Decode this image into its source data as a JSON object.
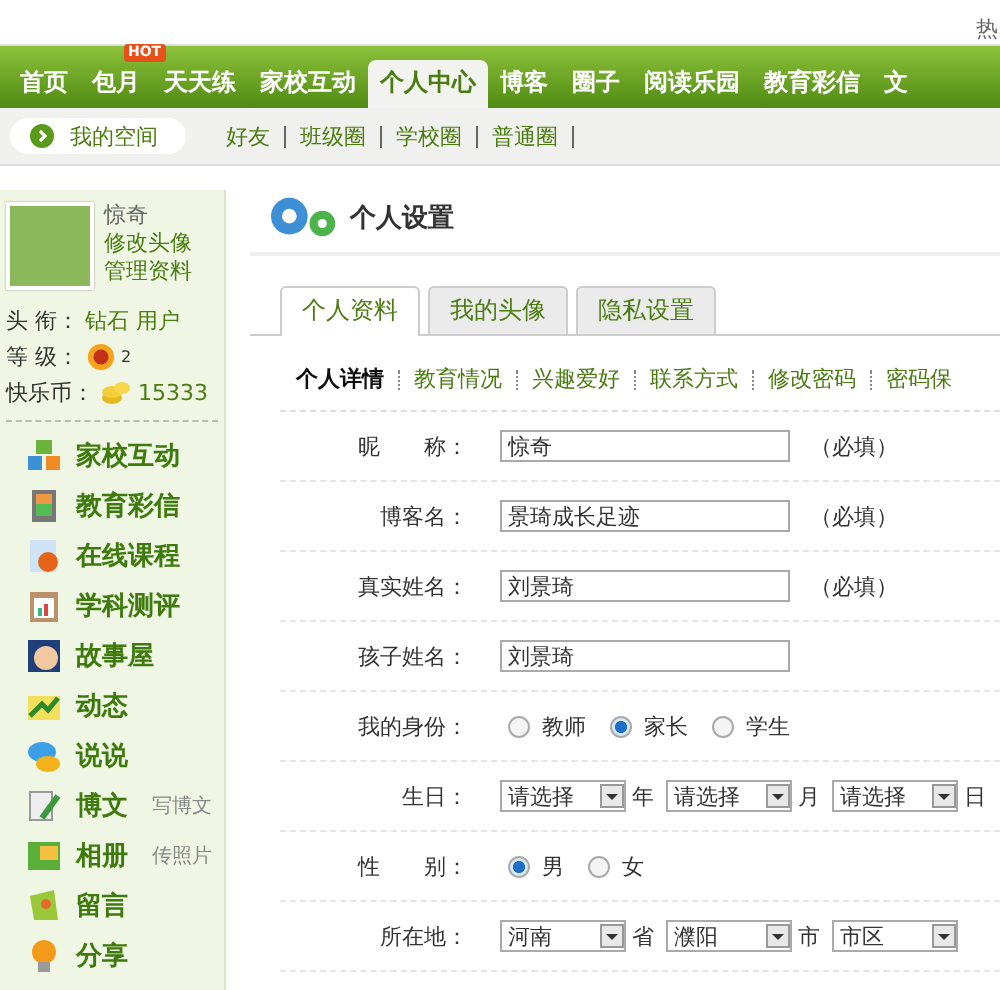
{
  "top_link": "热",
  "nav": [
    {
      "label": "首页",
      "selected": false
    },
    {
      "label": "包月",
      "selected": false,
      "badge": "HOT"
    },
    {
      "label": "天天练",
      "selected": false
    },
    {
      "label": "家校互动",
      "selected": false
    },
    {
      "label": "个人中心",
      "selected": true
    },
    {
      "label": "博客",
      "selected": false
    },
    {
      "label": "圈子",
      "selected": false
    },
    {
      "label": "阅读乐园",
      "selected": false
    },
    {
      "label": "教育彩信",
      "selected": false
    },
    {
      "label": "文",
      "selected": false
    }
  ],
  "subnav": {
    "home": "我的空间",
    "links": [
      "好友",
      "班级圈",
      "学校圈",
      "普通圈"
    ]
  },
  "profile": {
    "name": "惊奇",
    "links": [
      "修改头像",
      "管理资料"
    ],
    "stats": [
      {
        "kind": "text",
        "label": "头 衔：",
        "value": "钻石 用户"
      },
      {
        "kind": "level",
        "label": "等 级：",
        "value": "2"
      },
      {
        "kind": "coins",
        "label": "快乐币：",
        "value": "15333"
      }
    ]
  },
  "menu": [
    {
      "label": "家校互动"
    },
    {
      "label": "教育彩信"
    },
    {
      "label": "在线课程"
    },
    {
      "label": "学科测评"
    },
    {
      "label": "故事屋"
    },
    {
      "label": "动态"
    },
    {
      "label": "说说"
    },
    {
      "label": "博文",
      "action": "写博文"
    },
    {
      "label": "相册",
      "action": "传照片"
    },
    {
      "label": "留言"
    },
    {
      "label": "分享"
    }
  ],
  "page_title": "个人设置",
  "tabs": [
    {
      "label": "个人资料",
      "selected": true
    },
    {
      "label": "我的头像",
      "selected": false
    },
    {
      "label": "隐私设置",
      "selected": false
    }
  ],
  "subtabs": [
    {
      "label": "个人详情",
      "selected": true
    },
    {
      "label": "教育情况",
      "selected": false
    },
    {
      "label": "兴趣爱好",
      "selected": false
    },
    {
      "label": "联系方式",
      "selected": false
    },
    {
      "label": "修改密码",
      "selected": false
    },
    {
      "label": "密码保",
      "selected": false
    }
  ],
  "form": [
    {
      "kind": "text",
      "label": "昵　　称：",
      "value": "惊奇",
      "note": "（必填）"
    },
    {
      "kind": "text",
      "label": "博客名：",
      "value": "景琦成长足迹",
      "note": "（必填）"
    },
    {
      "kind": "text",
      "label": "真实姓名：",
      "value": "刘景琦",
      "note": "（必填）"
    },
    {
      "kind": "text",
      "label": "孩子姓名：",
      "value": "刘景琦"
    },
    {
      "kind": "radio",
      "label": "我的身份：",
      "options": [
        {
          "label": "教师",
          "selected": false
        },
        {
          "label": "家长",
          "selected": true
        },
        {
          "label": "学生",
          "selected": false
        }
      ]
    },
    {
      "kind": "select",
      "label": "生日：",
      "selects": [
        {
          "value": "请选择",
          "unit": "年"
        },
        {
          "value": "请选择",
          "unit": "月"
        },
        {
          "value": "请选择",
          "unit": "日"
        }
      ]
    },
    {
      "kind": "radio",
      "label": "性　　别：",
      "options": [
        {
          "label": "男",
          "selected": true
        },
        {
          "label": "女",
          "selected": false
        }
      ]
    },
    {
      "kind": "select",
      "label": "所在地：",
      "selects": [
        {
          "value": "河南",
          "unit": "省"
        },
        {
          "value": "濮阳",
          "unit": "市"
        },
        {
          "value": "市区"
        }
      ]
    }
  ]
}
